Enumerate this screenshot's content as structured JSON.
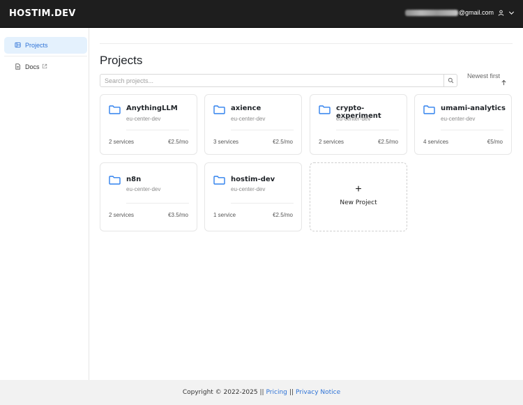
{
  "header": {
    "brand": "HOSTIM.DEV",
    "email_domain": "@gmail.com"
  },
  "sidebar": {
    "items": [
      {
        "label": "Projects",
        "icon": "projects-icon",
        "active": true
      },
      {
        "label": "Docs",
        "icon": "document-icon",
        "external": true
      }
    ]
  },
  "main": {
    "title": "Projects",
    "search": {
      "placeholder": "Search projects...",
      "value": ""
    },
    "sort": {
      "label": "Newest first"
    }
  },
  "projects": [
    {
      "name": "AnythingLLM",
      "region": "eu-center-dev",
      "services": "2 services",
      "price": "€2.5/mo"
    },
    {
      "name": "axience",
      "region": "eu-center-dev",
      "services": "3 services",
      "price": "€2.5/mo"
    },
    {
      "name": "crypto-experiment",
      "region": "eu-center-dev",
      "services": "2 services",
      "price": "€2.5/mo"
    },
    {
      "name": "umami-analytics",
      "region": "eu-center-dev",
      "services": "4 services",
      "price": "€5/mo"
    },
    {
      "name": "n8n",
      "region": "eu-center-dev",
      "services": "2 services",
      "price": "€3.5/mo"
    },
    {
      "name": "hostim-dev",
      "region": "eu-center-dev",
      "services": "1 service",
      "price": "€2.5/mo"
    }
  ],
  "new_project": {
    "plus": "+",
    "label": "New Project"
  },
  "footer": {
    "copyright": "Copyright © 2022-2025 ||",
    "pricing": "Pricing",
    "separator": "||",
    "privacy": "Privacy Notice"
  },
  "colors": {
    "accent": "#2f73d6",
    "header_bg": "#1e1e1e",
    "active_nav_bg": "#e4f1fd",
    "folder_icon": "#2f80ed"
  }
}
